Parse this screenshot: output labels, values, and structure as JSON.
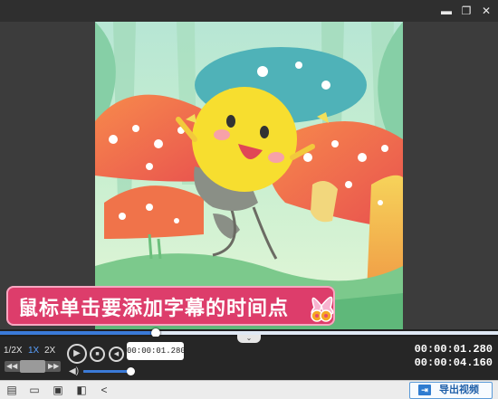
{
  "window": {
    "minimize_icon": "minimize-icon",
    "restore_icon": "restore-icon",
    "close_icon": "close-icon"
  },
  "player": {
    "subtitle_text": "鼠标单击要添加字幕的时间点",
    "progress_fraction": 0.313,
    "speeds": [
      "1/2X",
      "1X",
      "2X"
    ],
    "active_speed": "1X",
    "current_time_pill": "00:00:01.280",
    "volume_fraction": 0.93,
    "current_time": "00:00:01.280",
    "total_time": "00:00:04.160",
    "collapse_glyph": "⌄"
  },
  "toolbar": {
    "icons": [
      "new-file-icon",
      "open-folder-icon",
      "save-icon",
      "save-as-icon",
      "share-icon"
    ],
    "export_label": "导出视频"
  },
  "colors": {
    "accent": "#3a7ad8",
    "subtitle_banner": "#dd3d6b",
    "titlebar": "#2f2f2f",
    "controls_bg": "#262626"
  }
}
